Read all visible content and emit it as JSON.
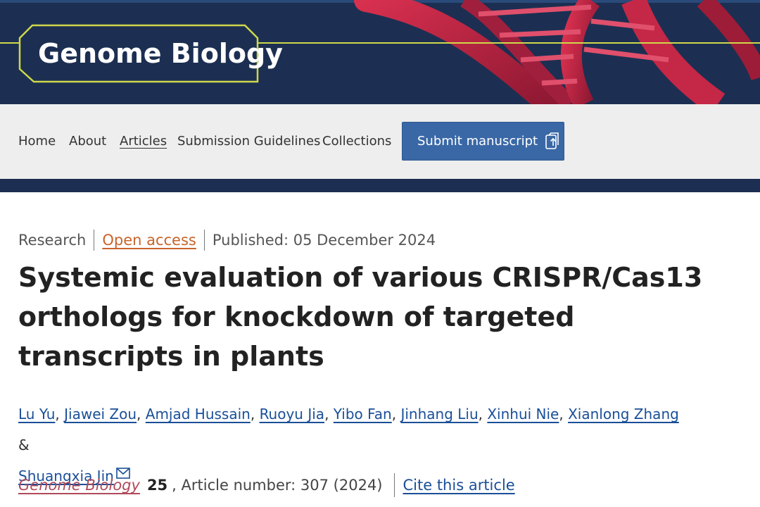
{
  "header": {
    "logo_text": "Genome Biology",
    "accent_color": "#cfd84a",
    "background_color": "#1c2f52"
  },
  "nav": {
    "items": [
      {
        "label": "Home"
      },
      {
        "label": "About"
      },
      {
        "label": "Articles"
      },
      {
        "label": "Submission Guidelines"
      },
      {
        "label": "Collections"
      }
    ],
    "submit_label": "Submit manuscript",
    "submit_icon": "external-submit-icon"
  },
  "article": {
    "type": "Research",
    "access": "Open access",
    "published": "Published: 05 December 2024",
    "title": "Systemic evaluation of various CRISPR/Cas13 orthologs for knockdown of targeted transcripts in plants",
    "authors": [
      "Lu Yu",
      "Jiawei Zou",
      "Amjad Hussain",
      "Ruoyu Jia",
      "Yibo Fan",
      "Jinhang Liu",
      "Xinhui Nie",
      "Xianlong Zhang",
      "Shuangxia Jin"
    ],
    "author_connector": "&",
    "journal": "Genome Biology",
    "volume": "25",
    "article_number": ", Article number: 307 (2024)",
    "cite_label": "Cite this article"
  }
}
